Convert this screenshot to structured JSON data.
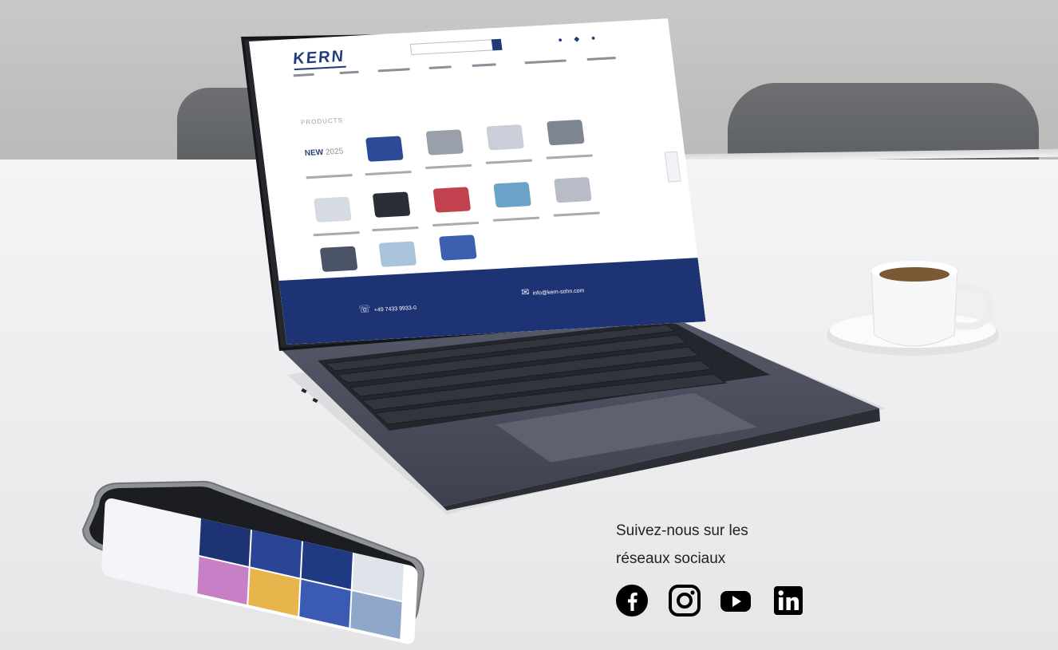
{
  "laptop_site": {
    "logo": "KERN",
    "section_title": "PRODUCTS",
    "new_badge_word": "NEW",
    "new_badge_year": "2025",
    "footer_phone": "+49 7433 9933-0",
    "footer_email": "info@kern-sohn.com"
  },
  "social": {
    "line1": "Suivez-nous sur les",
    "line2": "réseaux sociaux",
    "icons": [
      "facebook-icon",
      "instagram-icon",
      "youtube-icon",
      "linkedin-icon"
    ]
  },
  "colors": {
    "brand_navy": "#1d3373",
    "text_dark": "#222222"
  }
}
